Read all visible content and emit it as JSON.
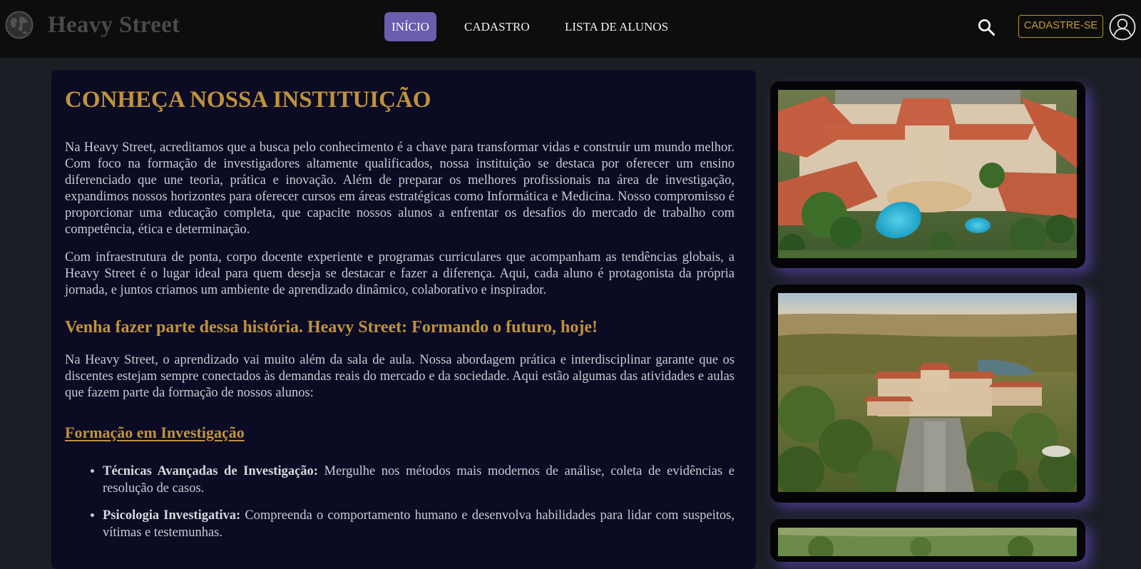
{
  "header": {
    "logo_text": "Heavy Street",
    "nav": [
      "INÍCIO",
      "CADASTRO",
      "LISTA DE ALUNOS"
    ],
    "active_nav": "INÍCIO",
    "signup_label": "CADASTRE-SE",
    "search_icon": "search-icon",
    "user_icon": "user-icon",
    "logo_icon": "globe-icon"
  },
  "main": {
    "title": "CONHEÇA NOSSA INSTITUIÇÃO",
    "paragraph1": "Na Heavy Street, acreditamos que a busca pelo conhecimento é a chave para transformar vidas e construir um mundo melhor. Com foco na formação de investigadores altamente qualificados, nossa instituição se destaca por oferecer um ensino diferenciado que une teoria, prática e inovação. Além de preparar os melhores profissionais na área de investigação, expandimos nossos horizontes para oferecer cursos em áreas estratégicas como Informática e Medicina. Nosso compromisso é proporcionar uma educação completa, que capacite nossos alunos a enfrentar os desafios do mercado de trabalho com competência, ética e determinação.",
    "paragraph2": "Com infraestrutura de ponta, corpo docente experiente e programas curriculares que acompanham as tendências globais, a Heavy Street é o lugar ideal para quem deseja se destacar e fazer a diferença. Aqui, cada aluno é protagonista da própria jornada, e juntos criamos um ambiente de aprendizado dinâmico, colaborativo e inspirador.",
    "subtitle": "Venha fazer parte dessa história. Heavy Street: Formando o futuro, hoje!",
    "paragraph3": "Na Heavy Street, o aprendizado vai muito além da sala de aula. Nossa abordagem prática e interdisciplinar garante que os discentes estejam sempre conectados às demandas reais do mercado e da sociedade. Aqui estão algumas das atividades e aulas que fazem parte da formação de nossos alunos:",
    "section_title": "Formação em Investigação",
    "bullets": [
      {
        "title": "Técnicas Avançadas de Investigação:",
        "text": " Mergulhe nos métodos mais modernos de análise, coleta de evidências e resolução de casos."
      },
      {
        "title": "Psicologia Investigativa:",
        "text": " Compreenda o comportamento humano e desenvolva habilidades para lidar com suspeitos, vítimas e testemunhas."
      }
    ]
  },
  "colors": {
    "accent_gold": "#c0933b",
    "nav_active": "#6b5cae",
    "card_bg": "#0b0b24",
    "page_bg": "#1b1e24",
    "glow": "#6e50dc"
  }
}
